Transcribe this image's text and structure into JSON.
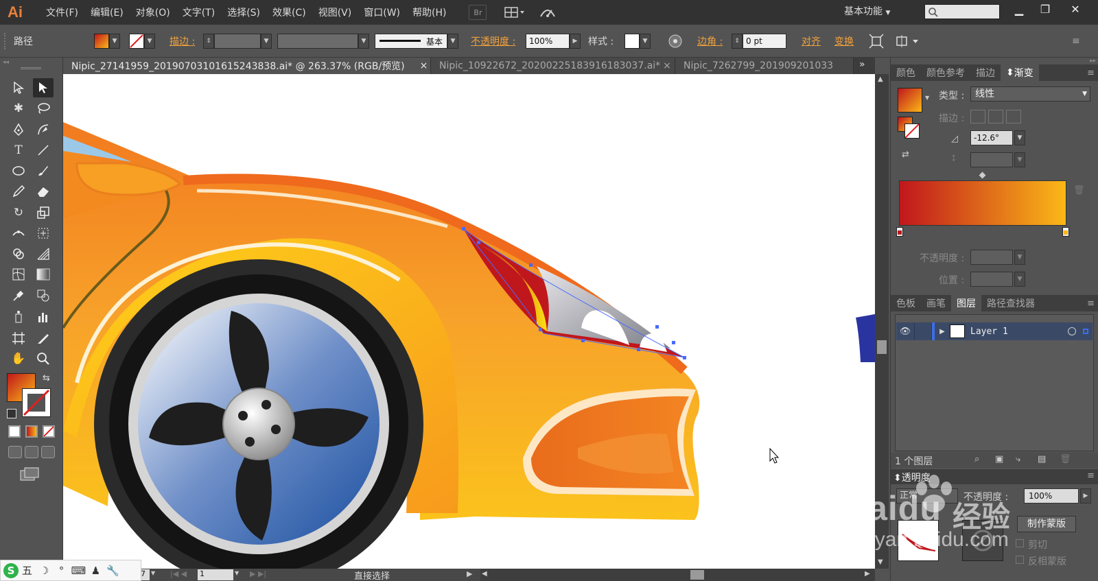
{
  "app": {
    "logo": "Ai",
    "workspace": "基本功能"
  },
  "menu": [
    "文件(F)",
    "编辑(E)",
    "对象(O)",
    "文字(T)",
    "选择(S)",
    "效果(C)",
    "视图(V)",
    "窗口(W)",
    "帮助(H)"
  ],
  "menu_icons": {
    "bridge": "Br"
  },
  "control": {
    "selection_type": "路径",
    "stroke_label": "描边 :",
    "brush_label": "基本",
    "opacity_label": "不透明度 :",
    "opacity_value": "100%",
    "style_label": "样式 :",
    "corner_label": "边角 :",
    "corner_value": "0 pt",
    "align_label": "对齐",
    "transform_label": "变换"
  },
  "tabs": [
    {
      "label": "Nipic_27141959_20190703101615243838.ai* @ 263.37% (RGB/预览)",
      "close": "×"
    },
    {
      "label": "Nipic_10922672_20200225183916183037.ai*",
      "close": "×"
    },
    {
      "label": "Nipic_7262799_201909201033",
      "close": ""
    }
  ],
  "tabs_more": "»",
  "gradient_panel": {
    "tabs": [
      "颜色",
      "颜色参考",
      "描边",
      "渐变"
    ],
    "type_label": "类型 :",
    "type_value": "线性",
    "stroke_label": "描边 :",
    "angle_value": "-12.6°",
    "opacity_label": "不透明度 :",
    "position_label": "位置 :",
    "gradient_start": "#c0171c",
    "gradient_end": "#fbb817"
  },
  "layers_panel": {
    "tabs": [
      "色板",
      "画笔",
      "图层",
      "路径查找器"
    ],
    "layer_name": "Layer 1",
    "layer_count": "1 个图层"
  },
  "transparency_panel": {
    "title": "透明度",
    "blend_mode": "正常",
    "opacity_label": "不透明度 :",
    "opacity_value": "100%",
    "make_mask_button": "制作蒙版",
    "clip_label": "剪切",
    "invert_label": "反相蒙版"
  },
  "status": {
    "zoom_fragment": "37",
    "artboard": "1",
    "tool_name": "直接选择"
  },
  "ime": [
    "S",
    "五",
    "☽",
    "°",
    "⌨",
    "♟",
    "🔧"
  ],
  "watermark": {
    "brand": "Baidu",
    "product": "经验",
    "url": "jingyan.baidu.com"
  }
}
